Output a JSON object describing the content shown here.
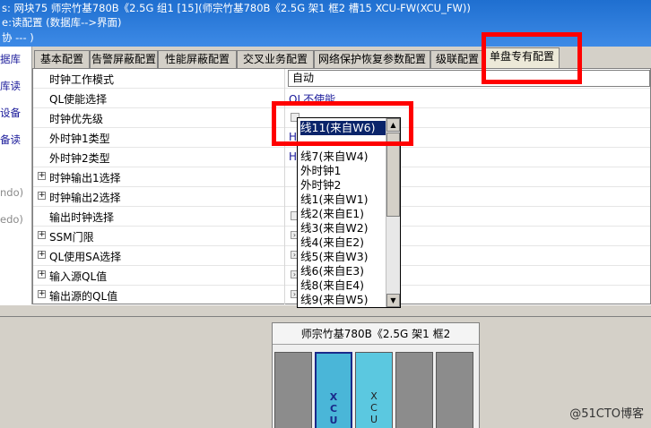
{
  "window": {
    "title_line1": "s: 网块75 师宗竹基780B《2.5G 组1 [15](师宗竹基780B《2.5G 架1 框2 槽15 XCU-FW(XCU_FW))",
    "title_line2": "e:读配置 (数据库-->界面)",
    "title_line3": "协 --- )"
  },
  "left_nav": {
    "items": [
      "据库",
      "库读",
      "设备",
      "备读",
      "ndo)",
      "edo)"
    ]
  },
  "tabs": [
    "基本配置",
    "告警屏蔽配置",
    "性能屏蔽配置",
    "交叉业务配置",
    "网络保护恢复参数配置",
    "级联配置",
    "单盘专有配置"
  ],
  "properties": {
    "rows": [
      {
        "name": "时钟工作模式",
        "value": "自动"
      },
      {
        "name": "QL使能选择",
        "value": "QL不使能"
      },
      {
        "name": "时钟优先级",
        "value": ""
      },
      {
        "name": "外时钟1类型",
        "value": "H"
      },
      {
        "name": "外时钟2类型",
        "value": "H"
      },
      {
        "name": "时钟输出1选择",
        "value": ""
      },
      {
        "name": "时钟输出2选择",
        "value": ""
      },
      {
        "name": "输出时钟选择",
        "value": ""
      },
      {
        "name": "SSM门限",
        "value": ""
      },
      {
        "name": "QL使用SA选择",
        "value": ""
      },
      {
        "name": "输入源QL值",
        "value": ""
      },
      {
        "name": "输出源的QL值",
        "value": ""
      }
    ]
  },
  "dropdown": {
    "options": [
      "线11(来自W6)",
      "线7(来自W4)",
      "外时钟1",
      "外时钟2",
      "线1(来自W1)",
      "线2(来自E1)",
      "线3(来自W2)",
      "线4(来自E2)",
      "线5(来自W3)",
      "线6(来自E3)",
      "线8(来自E4)",
      "线9(来自W5)"
    ],
    "selected_index": 0,
    "highlight_color": "#0a246a"
  },
  "chassis": {
    "title": "师宗竹基780B《2.5G 架1 框2",
    "slots": [
      {
        "label": ""
      },
      {
        "label": "X C U"
      },
      {
        "label": "X C U"
      },
      {
        "label": ""
      },
      {
        "label": ""
      }
    ]
  },
  "watermark": "@51CTO博客",
  "colors": {
    "highlight_red": "#ff0000",
    "card_blue": "#5bc8e0"
  }
}
